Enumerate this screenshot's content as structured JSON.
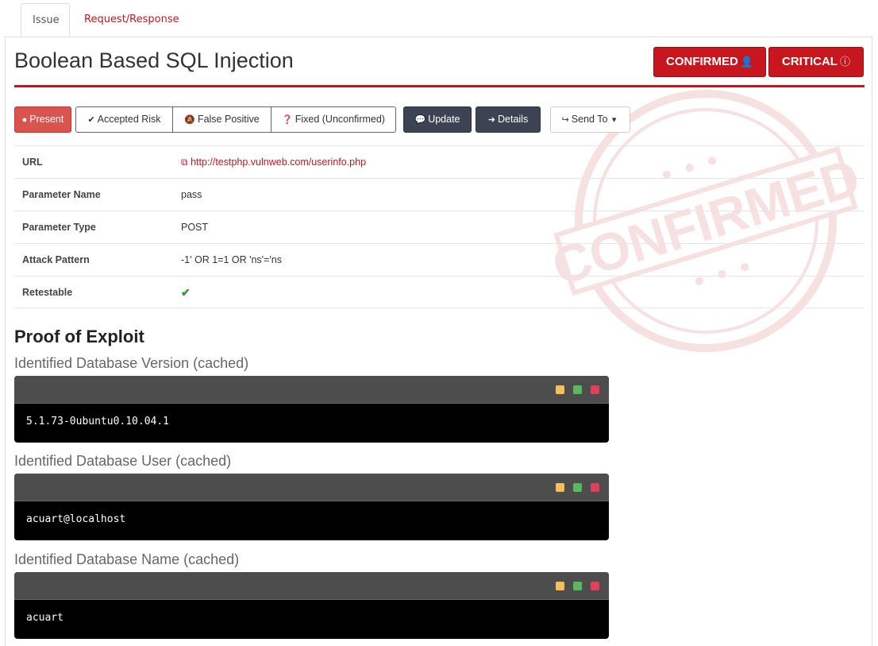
{
  "tabs": [
    {
      "label": "Issue",
      "active": true
    },
    {
      "label": "Request/Response",
      "active": false
    }
  ],
  "header": {
    "title": "Boolean Based SQL Injection",
    "confirmed_label": "CONFIRMED",
    "critical_label": "CRITICAL",
    "stamp_text": "CONFIRMED"
  },
  "actions": {
    "present": "Present",
    "accepted_risk": "Accepted Risk",
    "false_positive": "False Positive",
    "fixed_unconfirmed": "Fixed (Unconfirmed)",
    "update": "Update",
    "details": "Details",
    "send_to": "Send To"
  },
  "details": {
    "url_label": "URL",
    "url_value": "http://testphp.vulnweb.com/userinfo.php",
    "param_name_label": "Parameter Name",
    "param_name_value": "pass",
    "param_type_label": "Parameter Type",
    "param_type_value": "POST",
    "attack_label": "Attack Pattern",
    "attack_value": "-1' OR 1=1 OR 'ns'='ns",
    "retestable_label": "Retestable",
    "retestable_value": true
  },
  "proof": {
    "title": "Proof of Exploit",
    "sections": [
      {
        "title": "Identified Database Version (cached)",
        "output": "5.1.73-0ubuntu0.10.04.1"
      },
      {
        "title": "Identified Database User (cached)",
        "output": "acuart@localhost"
      },
      {
        "title": "Identified Database Name (cached)",
        "output": "acuart"
      }
    ]
  },
  "colors": {
    "brand_red": "#c7161d",
    "present_red": "#d9534f",
    "dark_button": "#3c4454",
    "terminal_bar": "#4d4d4d"
  }
}
